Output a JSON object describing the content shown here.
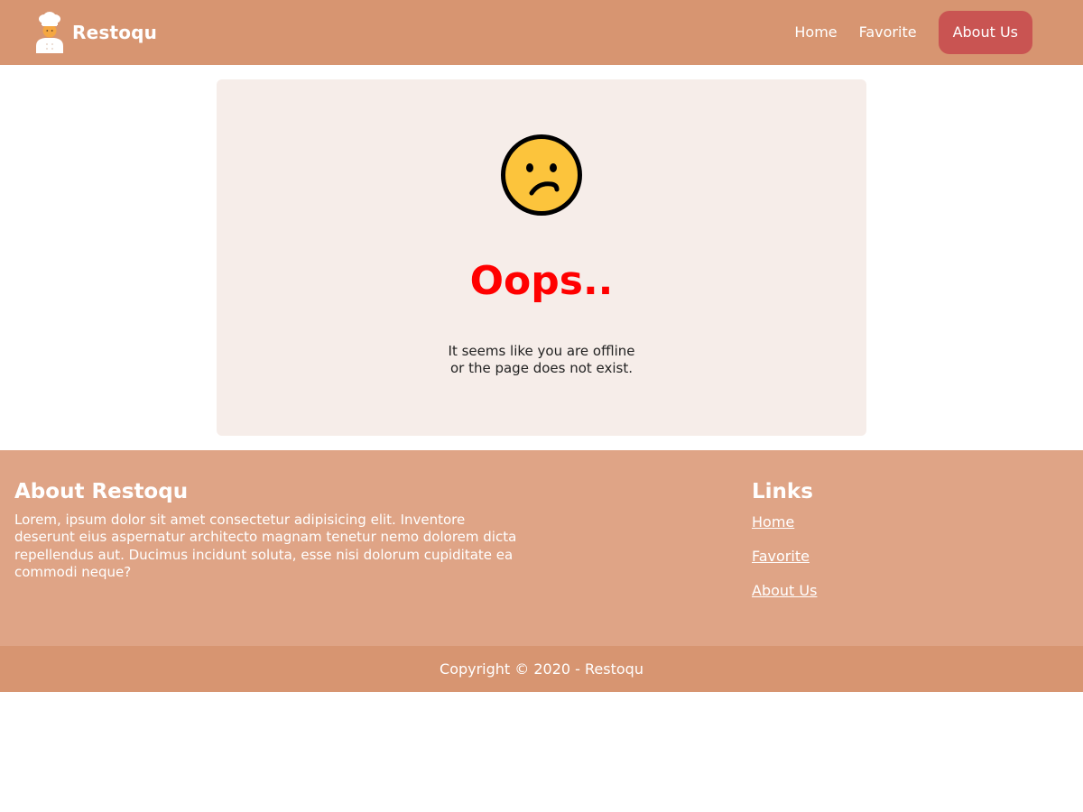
{
  "header": {
    "brand_name": "Restoqu",
    "brand_icon": "chef-icon",
    "nav": [
      {
        "label": "Home",
        "active": false
      },
      {
        "label": "Favorite",
        "active": false
      },
      {
        "label": "About Us",
        "active": true
      }
    ]
  },
  "main": {
    "emoji_icon": "confused-face-icon",
    "title": "Oops..",
    "message_line1": "It seems like you are offline",
    "message_line2": "or the page does not exist."
  },
  "footer": {
    "about_title": "About Restoqu",
    "about_text": "Lorem, ipsum dolor sit amet consectetur adipisicing elit. Inventore deserunt eius aspernatur architecto magnam tenetur nemo dolorem dicta repellendus aut. Ducimus incidunt soluta, esse nisi dolorum cupiditate ea commodi neque?",
    "links_title": "Links",
    "links": [
      {
        "label": "Home"
      },
      {
        "label": "Favorite"
      },
      {
        "label": "About Us"
      }
    ],
    "copyright": "Copyright © 2020 - Restoqu"
  },
  "colors": {
    "header_bg": "#d79571",
    "footer_bg": "#dfa486",
    "active_nav_bg": "#c95452",
    "card_bg": "#f6ede9",
    "title_color": "#ff0000"
  }
}
